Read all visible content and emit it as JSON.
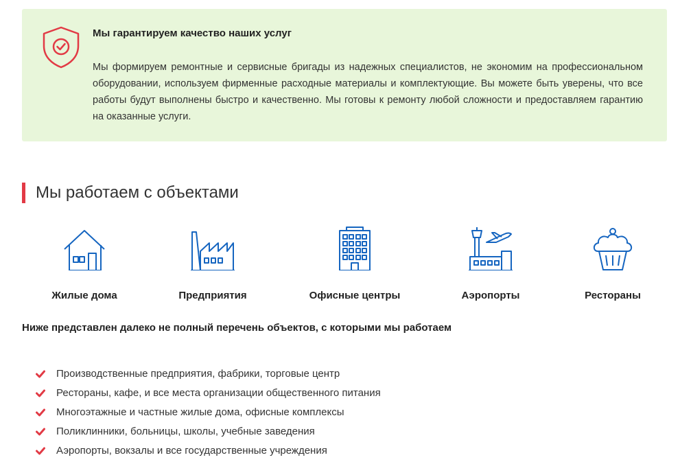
{
  "guarantee": {
    "title": "Мы гарантируем качество наших услуг",
    "text": "Мы формируем ремонтные и сервисные бригады из надежных специалистов, не экономим на профессиональном оборудовании, используем фирменные расходные материалы и комплектующие. Вы можете быть уверены, что все работы будут выполнены быстро и качественно. Мы готовы к ремонту любой сложности и предоставляем гарантию на оказанные услуги.",
    "icon": "shield-check-icon"
  },
  "section": {
    "title": "Мы работаем с объектами"
  },
  "objects": [
    {
      "label": "Жилые дома",
      "icon": "house-icon"
    },
    {
      "label": "Предприятия",
      "icon": "factory-icon"
    },
    {
      "label": "Офисные центры",
      "icon": "office-building-icon"
    },
    {
      "label": "Аэропорты",
      "icon": "airport-icon"
    },
    {
      "label": "Рестораны",
      "icon": "cupcake-icon"
    }
  ],
  "list": {
    "intro": "Ниже представлен далеко не полный перечень объектов, с которыми мы работаем",
    "items": [
      "Производственные предприятия, фабрики, торговые центр",
      "Рестораны, кафе, и все места организации общественного питания",
      "Многоэтажные и частные жилые дома, офисные комплексы",
      "Поликлинники, больницы, школы, учебные заведения",
      "Аэропорты, вокзалы и все государственные учреждения"
    ]
  },
  "colors": {
    "accent": "#e23a45",
    "icon_blue": "#1565c0",
    "panel_bg": "#e8f6da"
  }
}
